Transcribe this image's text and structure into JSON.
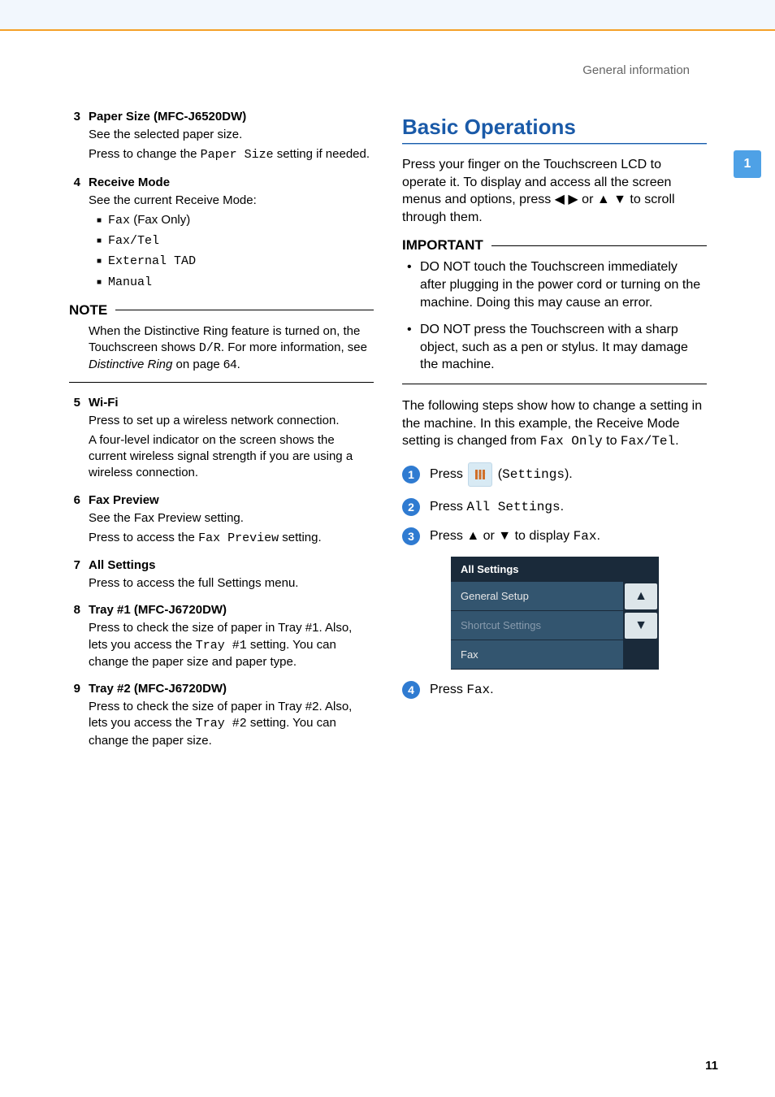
{
  "running_head": "General information",
  "side_tab": "1",
  "page_number": "11",
  "left": {
    "items": [
      {
        "n": "3",
        "title": "Paper Size (MFC-J6520DW)",
        "lines": [
          {
            "t": "See the selected paper size."
          },
          {
            "pre": "Press to change the ",
            "mono": "Paper Size",
            "post": " setting if needed."
          }
        ]
      },
      {
        "n": "4",
        "title": "Receive Mode",
        "lines": [
          {
            "t": "See the current Receive Mode:"
          }
        ],
        "bullets": [
          {
            "mono": "Fax",
            "post": " (Fax Only)"
          },
          {
            "mono": "Fax/Tel"
          },
          {
            "mono": "External TAD"
          },
          {
            "mono": "Manual"
          }
        ]
      }
    ],
    "note_head": "NOTE",
    "note": {
      "pre1": "When the Distinctive Ring feature is turned on, the Touchscreen shows ",
      "mono1": "D/R",
      "mid1": ". For more information, see ",
      "ital1": "Distinctive Ring",
      "post1": " on page 64."
    },
    "items2": [
      {
        "n": "5",
        "title": "Wi-Fi",
        "lines": [
          {
            "t": "Press to set up a wireless network connection."
          },
          {
            "t": "A four-level indicator on the screen shows the current wireless signal strength if you are using a wireless connection."
          }
        ]
      },
      {
        "n": "6",
        "title": "Fax Preview",
        "lines": [
          {
            "t": "See the Fax Preview setting."
          },
          {
            "pre": "Press to access the ",
            "mono": "Fax Preview",
            "post": " setting."
          }
        ]
      },
      {
        "n": "7",
        "title": "All Settings",
        "lines": [
          {
            "t": "Press to access the full Settings menu."
          }
        ]
      },
      {
        "n": "8",
        "title": "Tray #1 (MFC-J6720DW)",
        "lines": [
          {
            "pre": "Press to check the size of paper in Tray #1. Also, lets you access the ",
            "mono": "Tray #1",
            "post": " setting. You can change the paper size and paper type."
          }
        ]
      },
      {
        "n": "9",
        "title": "Tray #2 (MFC-J6720DW)",
        "lines": [
          {
            "pre": "Press to check the size of paper in Tray #2. Also, lets you access the ",
            "mono": "Tray #2",
            "post": " setting. You can change the paper size."
          }
        ]
      }
    ]
  },
  "right": {
    "h1": "Basic Operations",
    "intro": {
      "pre": "Press your finger on the Touchscreen LCD to operate it. To display and access all the screen menus and options, press ",
      "arrows1": "◀ ▶",
      "mid": " or ",
      "arrows2": "▲ ▼",
      "post": " to scroll through them."
    },
    "imp_head": "IMPORTANT",
    "important": [
      "DO NOT touch the Touchscreen immediately after plugging in the power cord or turning on the machine. Doing this may cause an error.",
      "DO NOT press the Touchscreen with a sharp object, such as a pen or stylus. It may damage the machine."
    ],
    "following": {
      "pre": "The following steps show how to change a setting in the machine. In this example, the Receive Mode setting is changed from ",
      "mono1": "Fax Only",
      "mid": " to ",
      "mono2": "Fax/Tel",
      "post": "."
    },
    "steps": {
      "s1_pre": "Press ",
      "s1_paren_open": " (",
      "s1_mono": "Settings",
      "s1_paren_close": ").",
      "s2_pre": "Press ",
      "s2_mono": "All Settings",
      "s2_post": ".",
      "s3_pre": "Press ",
      "s3_arrows": "▲ or ▼",
      "s3_mid": " to display ",
      "s3_mono": "Fax",
      "s3_post": ".",
      "s4_pre": "Press ",
      "s4_mono": "Fax",
      "s4_post": "."
    },
    "lcd": {
      "title": "All Settings",
      "rows": [
        "General Setup",
        "Shortcut Settings",
        "Fax"
      ],
      "up": "▲",
      "down": "▼"
    }
  }
}
